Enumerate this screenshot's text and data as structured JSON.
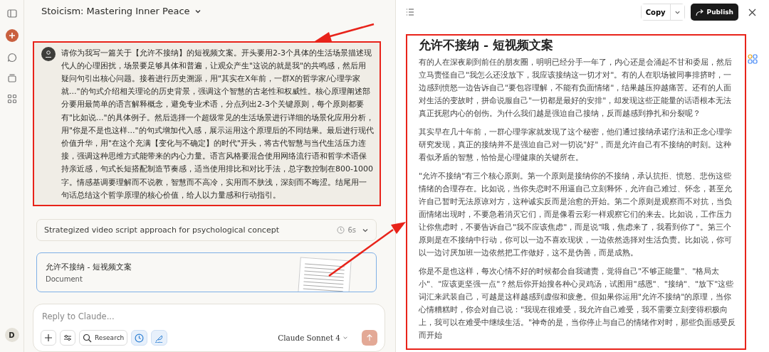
{
  "sidebar": {
    "avatar": "D"
  },
  "chat": {
    "title": "Stoicism: Mastering Inner Peace",
    "user_message": "请你为我写一篇关于【允许不接纳】的短视频文案。开头要用2-3个具体的生活场景描述现代人的心理困扰，场景要足够具体和普遍，让观众产生\"这说的就是我\"的共鸣感，然后用疑问句引出核心问题。接着进行历史溯源，用\"其实在X年前，一群X的哲学家/心理学家就...\"的句式介绍相关理论的历史背景，强调这个智慧的古老性和权威性。核心原理阐述部分要用最简单的语言解释概念，避免专业术语，分点列出2-3个关键原则，每个原则都要有\"比如说...\"的具体例子。然后选择一个超级常见的生活场景进行详细的场景化应用分析，用\"你是不是也这样...\"的句式增加代入感，展示运用这个原理后的不同结果。最后进行现代价值升华，用\"在这个充满【变化与不确定】的时代\"开头，将古代智慧与当代生活压力连接，强调这种思维方式能带来的内心力量。语言风格要混合使用网络流行语和哲学术语保持亲近感，句式长短搭配制造节奏感，适当使用排比和对比手法，总字数控制在800-1000字。情感基调要理解而不说教，智慧而不高冷，实用而不肤浅，深刻而不晦涩。结尾用一句话总结这个哲学原理的核心价值，给人以力量感和行动指引。",
    "thinking": {
      "summary": "Strategized video script approach for psychological concept",
      "duration": "6s",
      "expanded": false
    },
    "artifact": {
      "title": "允许不接纳 - 短视频文案",
      "type": "Document",
      "selected": true
    },
    "composer": {
      "placeholder": "Reply to Claude...",
      "research_label": "Research",
      "clock_on": true,
      "style_on": true,
      "model_name": "Claude",
      "model_version": "Sonnet 4"
    }
  },
  "document": {
    "copy_label": "Copy",
    "publish_label": "Publish",
    "title": "允许不接纳 - 短视频文案",
    "paragraphs": [
      "有的人在深夜刷到前任的朋友圈，明明已经分手一年了，内心还是会涌起不甘和委屈，然后立马责怪自己\"我怎么还没放下，我应该接纳这一切才对\"。有的人在职场被同事排挤时，一边感到愤怒一边告诉自己\"要包容理解，不能有负面情绪\"，结果越压抑越痛苦。还有的人面对生活的变故时，拼命说服自己\"一切都是最好的安排\"，却发现这些正能量的话语根本无法真正抚慰内心的创伤。为什么我们越是强迫自己接纳，反而越感到挣扎和分裂呢？",
      "其实早在几十年前，一群心理学家就发现了这个秘密，他们通过接纳承诺疗法和正念心理学研究发现，真正的接纳并不是强迫自己对一切说\"好\"，而是允许自己有不接纳的时刻。这种看似矛盾的智慧，恰恰是心理健康的关键所在。",
      "\"允许不接纳\"有三个核心原则。第一个原则是接纳你的不接纳，承认抗拒、愤怒、悲伤这些情绪的合理存在。比如说，当你失恋时不用逼自己立刻释怀，允许自己难过、怀念，甚至允许自己暂时无法原谅对方，这种诚实反而是治愈的开始。第二个原则是观察而不对抗，当负面情绪出现时，不要急着消灭它们，而是像看云彩一样观察它们的来去。比如说，工作压力让你焦虑时，不要告诉自己\"我不应该焦虑\"，而是说\"哦，焦虑来了，我看到你了\"。第三个原则是在不接纳中行动，你可以一边不喜欢现状，一边依然选择对生活负责。比如说，你可以一边讨厌加班一边依然把工作做好，这不是伪善，而是成熟。",
      "你是不是也这样，每次心情不好的时候都会自我谴责，觉得自己\"不够正能量\"、\"格局太小\"、\"应该更坚强一点\"？然后你开始搜各种心灵鸡汤，试图用\"感恩\"、\"接纳\"、\"放下\"这些词汇来武装自己，可越是这样越感到虚假和疲惫。但如果你运用\"允许不接纳\"的原理，当你心情糟糕时，你会对自己说：\"我现在很难受，我允许自己难受，我不需要立刻变得积极向上，我可以在难受中继续生活。\"神奇的是，当你停止与自己的情绪作对时，那些负面感受反而开始"
    ]
  }
}
